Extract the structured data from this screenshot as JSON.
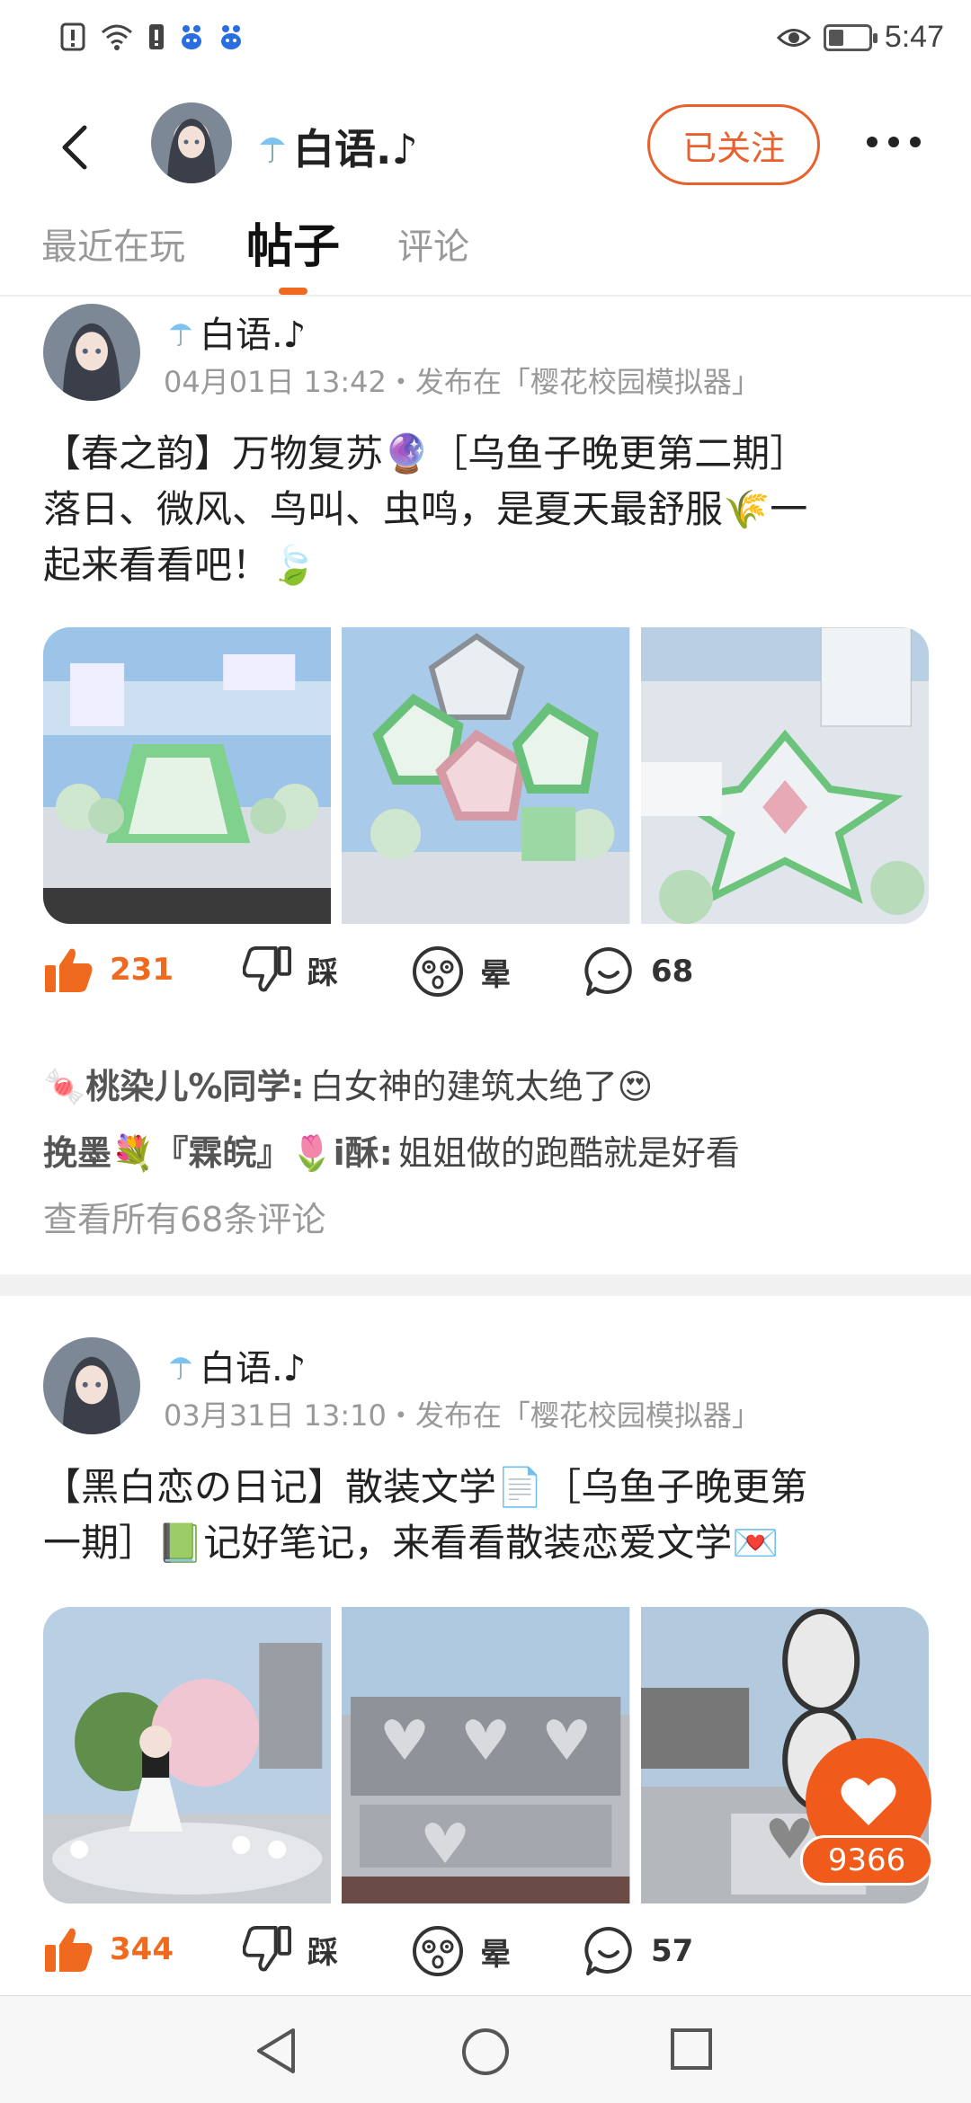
{
  "status_bar": {
    "time": "5:47"
  },
  "header": {
    "user_name": "白语.♪",
    "follow_label": "已关注"
  },
  "tabs": [
    {
      "label": "最近在玩",
      "active": false
    },
    {
      "label": "帖子",
      "active": true
    },
    {
      "label": "评论",
      "active": false
    }
  ],
  "posts": [
    {
      "author": "白语.♪",
      "meta": "04月01日 13:42・发布在「樱花校园模拟器」",
      "body_lines": [
        "【春之韵】万物复苏🔮［乌鱼子晚更第二期］",
        "落日、微风、鸟叫、虫鸣，是夏天最舒服🌾一",
        "起来看看吧！🍃"
      ],
      "likes": "231",
      "dislike_label": "踩",
      "dizzy_label": "晕",
      "comments_count": "68",
      "comments": [
        {
          "user": "🍬桃染儿%同学:",
          "text": "白女神的建筑太绝了😍"
        },
        {
          "user": "挽墨💐『霖皖』🌷i酥:",
          "text": "姐姐做的跑酷就是好看"
        }
      ],
      "view_all": "查看所有68条评论"
    },
    {
      "author": "白语.♪",
      "meta": "03月31日 13:10・发布在「樱花校园模拟器」",
      "body_lines": [
        "【黑白恋の日记】散装文学📄［乌鱼子晚更第",
        "一期］📗记好笔记，来看看散装恋爱文学💌"
      ],
      "likes": "344",
      "dislike_label": "踩",
      "dizzy_label": "晕",
      "comments_count": "57"
    }
  ],
  "floating_like": {
    "count": "9366"
  },
  "colors": {
    "accent": "#ef6a1f",
    "fab": "#f05a1a"
  },
  "icons": [
    "back-arrow-icon",
    "more-icon",
    "thumbs-up-icon",
    "thumbs-down-icon",
    "dizzy-face-icon",
    "comment-bubble-icon",
    "heart-icon"
  ]
}
